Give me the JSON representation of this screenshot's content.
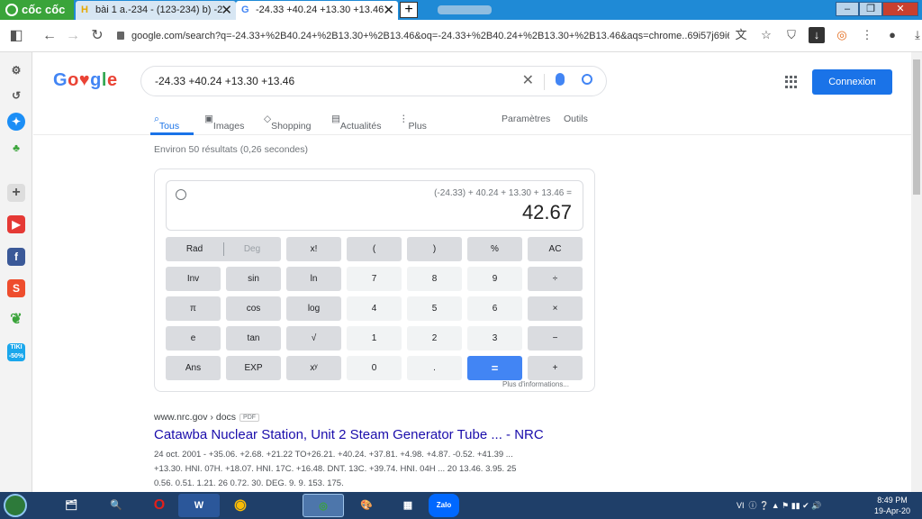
{
  "browser": {
    "brand": "cốc cốc",
    "tabs": [
      {
        "label": "bài 1 a.-234 - (123-234) b) -2",
        "favicon": "H"
      },
      {
        "label": "-24.33 +40.24 +13.30 +13.46",
        "favicon": "G"
      }
    ],
    "new_tab": "+",
    "url": "google.com/search?q=-24.33+%2B40.24+%2B13.30+%2B13.46&oq=-24.33+%2B40.24+%2B13.30+%2B13.46&aqs=chrome..69i57j69i61...."
  },
  "sidebar": {
    "items": [
      "settings-icon",
      "history-icon",
      "messenger-icon",
      "games-icon",
      "add-icon",
      "youtube-icon",
      "facebook-icon",
      "shopee-icon",
      "leaf-icon",
      "tiki-icon"
    ],
    "tiki_label": "TIKI -50%",
    "shopee_label": "S",
    "facebook_label": "f"
  },
  "google": {
    "logo": "Google",
    "query": "-24.33 +40.24 +13.30 +13.46",
    "signin": "Connexion",
    "tabs": [
      "Tous",
      "Images",
      "Shopping",
      "Actualités",
      "Plus"
    ],
    "tools": [
      "Paramètres",
      "Outils"
    ],
    "stats": "Environ 50 résultats (0,26 secondes)"
  },
  "calculator": {
    "expression": "(-24.33) + 40.24 + 13.30 + 13.46 =",
    "result": "42.67",
    "keys": [
      [
        "Rad",
        "Deg",
        "x!",
        "(",
        ")",
        "%",
        "AC"
      ],
      [
        "Inv",
        "sin",
        "ln",
        "7",
        "8",
        "9",
        "÷"
      ],
      [
        "π",
        "cos",
        "log",
        "4",
        "5",
        "6",
        "×"
      ],
      [
        "e",
        "tan",
        "√",
        "1",
        "2",
        "3",
        "−"
      ],
      [
        "Ans",
        "EXP",
        "xʸ",
        "0",
        ".",
        "=",
        "+"
      ]
    ],
    "more_info": "Plus d'informations..."
  },
  "result": {
    "url": "www.nrc.gov › docs",
    "badge": "PDF",
    "title": "Catawba Nuclear Station, Unit 2 Steam Generator Tube ... - NRC",
    "snippet_line1": "24 oct. 2001 - +35.06. +2.68. +21.22 TO+26.21. +40.24. +37.81. +4.98. +4.87. -0.52. +41.39 ...",
    "snippet_line2": "+13.30. HNI. 07H. +18.07. HNI. 17C. +16.48. DNT. 13C. +39.74. HNI. 04H ... 20 13.46. 3.95. 25",
    "snippet_line3": "0.56. 0.51. 1.21. 26 0.72. 30. DEG. 9. 9. 153. 175."
  },
  "taskbar": {
    "tray_lang": "VI",
    "time": "8:49 PM",
    "date": "19-Apr-20"
  },
  "colors": {
    "google_blue": "#4285f4",
    "link": "#1a0dab",
    "taskbar": "#1f3f69"
  }
}
